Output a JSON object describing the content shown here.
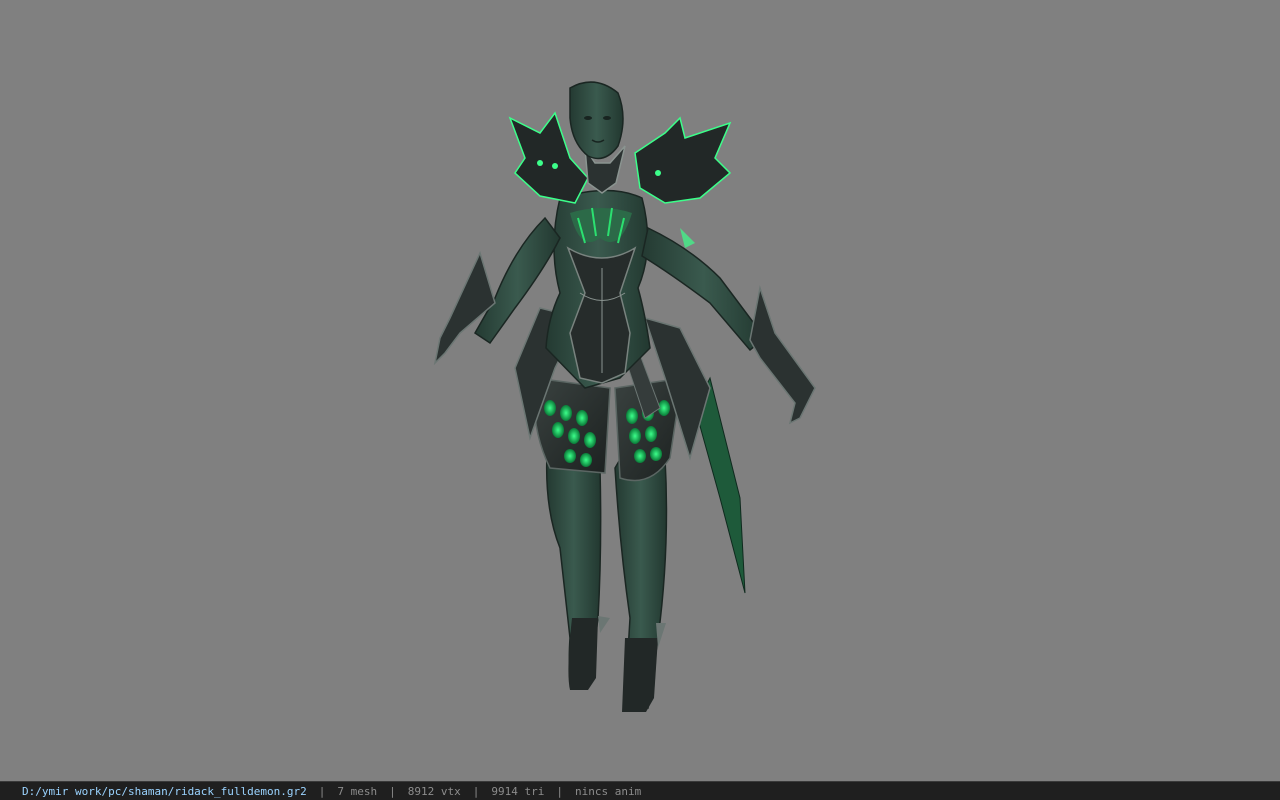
{
  "viewport": {
    "background_color": "#808080",
    "model_name": "ridack_fulldemon",
    "model_colors": {
      "skin": "#2e4a40",
      "armor": "#2a302e",
      "armor_edge": "#5b6663",
      "glow": "#12c85a"
    }
  },
  "status_bar": {
    "file_path": "D:/ymir work/pc/shaman/ridack_fulldemon.gr2",
    "separator": "|",
    "mesh_count": "7 mesh",
    "vertex_count": "8912 vtx",
    "triangle_count": "9914 tri",
    "animation": "nincs anim",
    "path_color": "#9ad3ff",
    "text_color": "#8c8c8c"
  }
}
